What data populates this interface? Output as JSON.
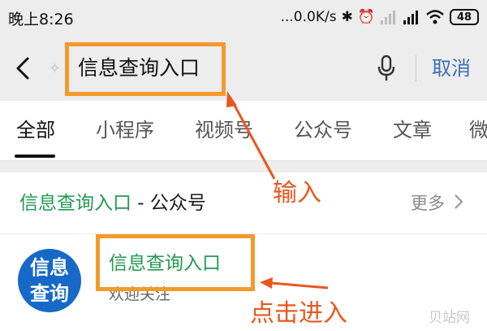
{
  "status_bar": {
    "time": "晚上8:26",
    "network_speed": "...0.0K/s",
    "battery": "48"
  },
  "search": {
    "query": "信息查询入口",
    "cancel_label": "取消"
  },
  "tabs": [
    {
      "label": "全部",
      "active": true
    },
    {
      "label": "小程序",
      "active": false
    },
    {
      "label": "视频号",
      "active": false
    },
    {
      "label": "公众号",
      "active": false
    },
    {
      "label": "文章",
      "active": false
    },
    {
      "label": "微",
      "active": false
    }
  ],
  "section": {
    "title_highlight": "信息查询入口",
    "title_suffix": " - 公众号",
    "more_label": "更多"
  },
  "result": {
    "avatar_line1": "信息",
    "avatar_line2": "查询",
    "name": "信息查询入口",
    "description": "欢迎关注"
  },
  "annotations": {
    "input_label": "输入",
    "click_label": "点击进入",
    "color": "#e8571e",
    "box_color": "#f39a2b"
  },
  "watermark": "贝站网",
  "colors": {
    "highlight": "#239a52",
    "link": "#3b6fb6",
    "avatar": "#1769c7"
  }
}
